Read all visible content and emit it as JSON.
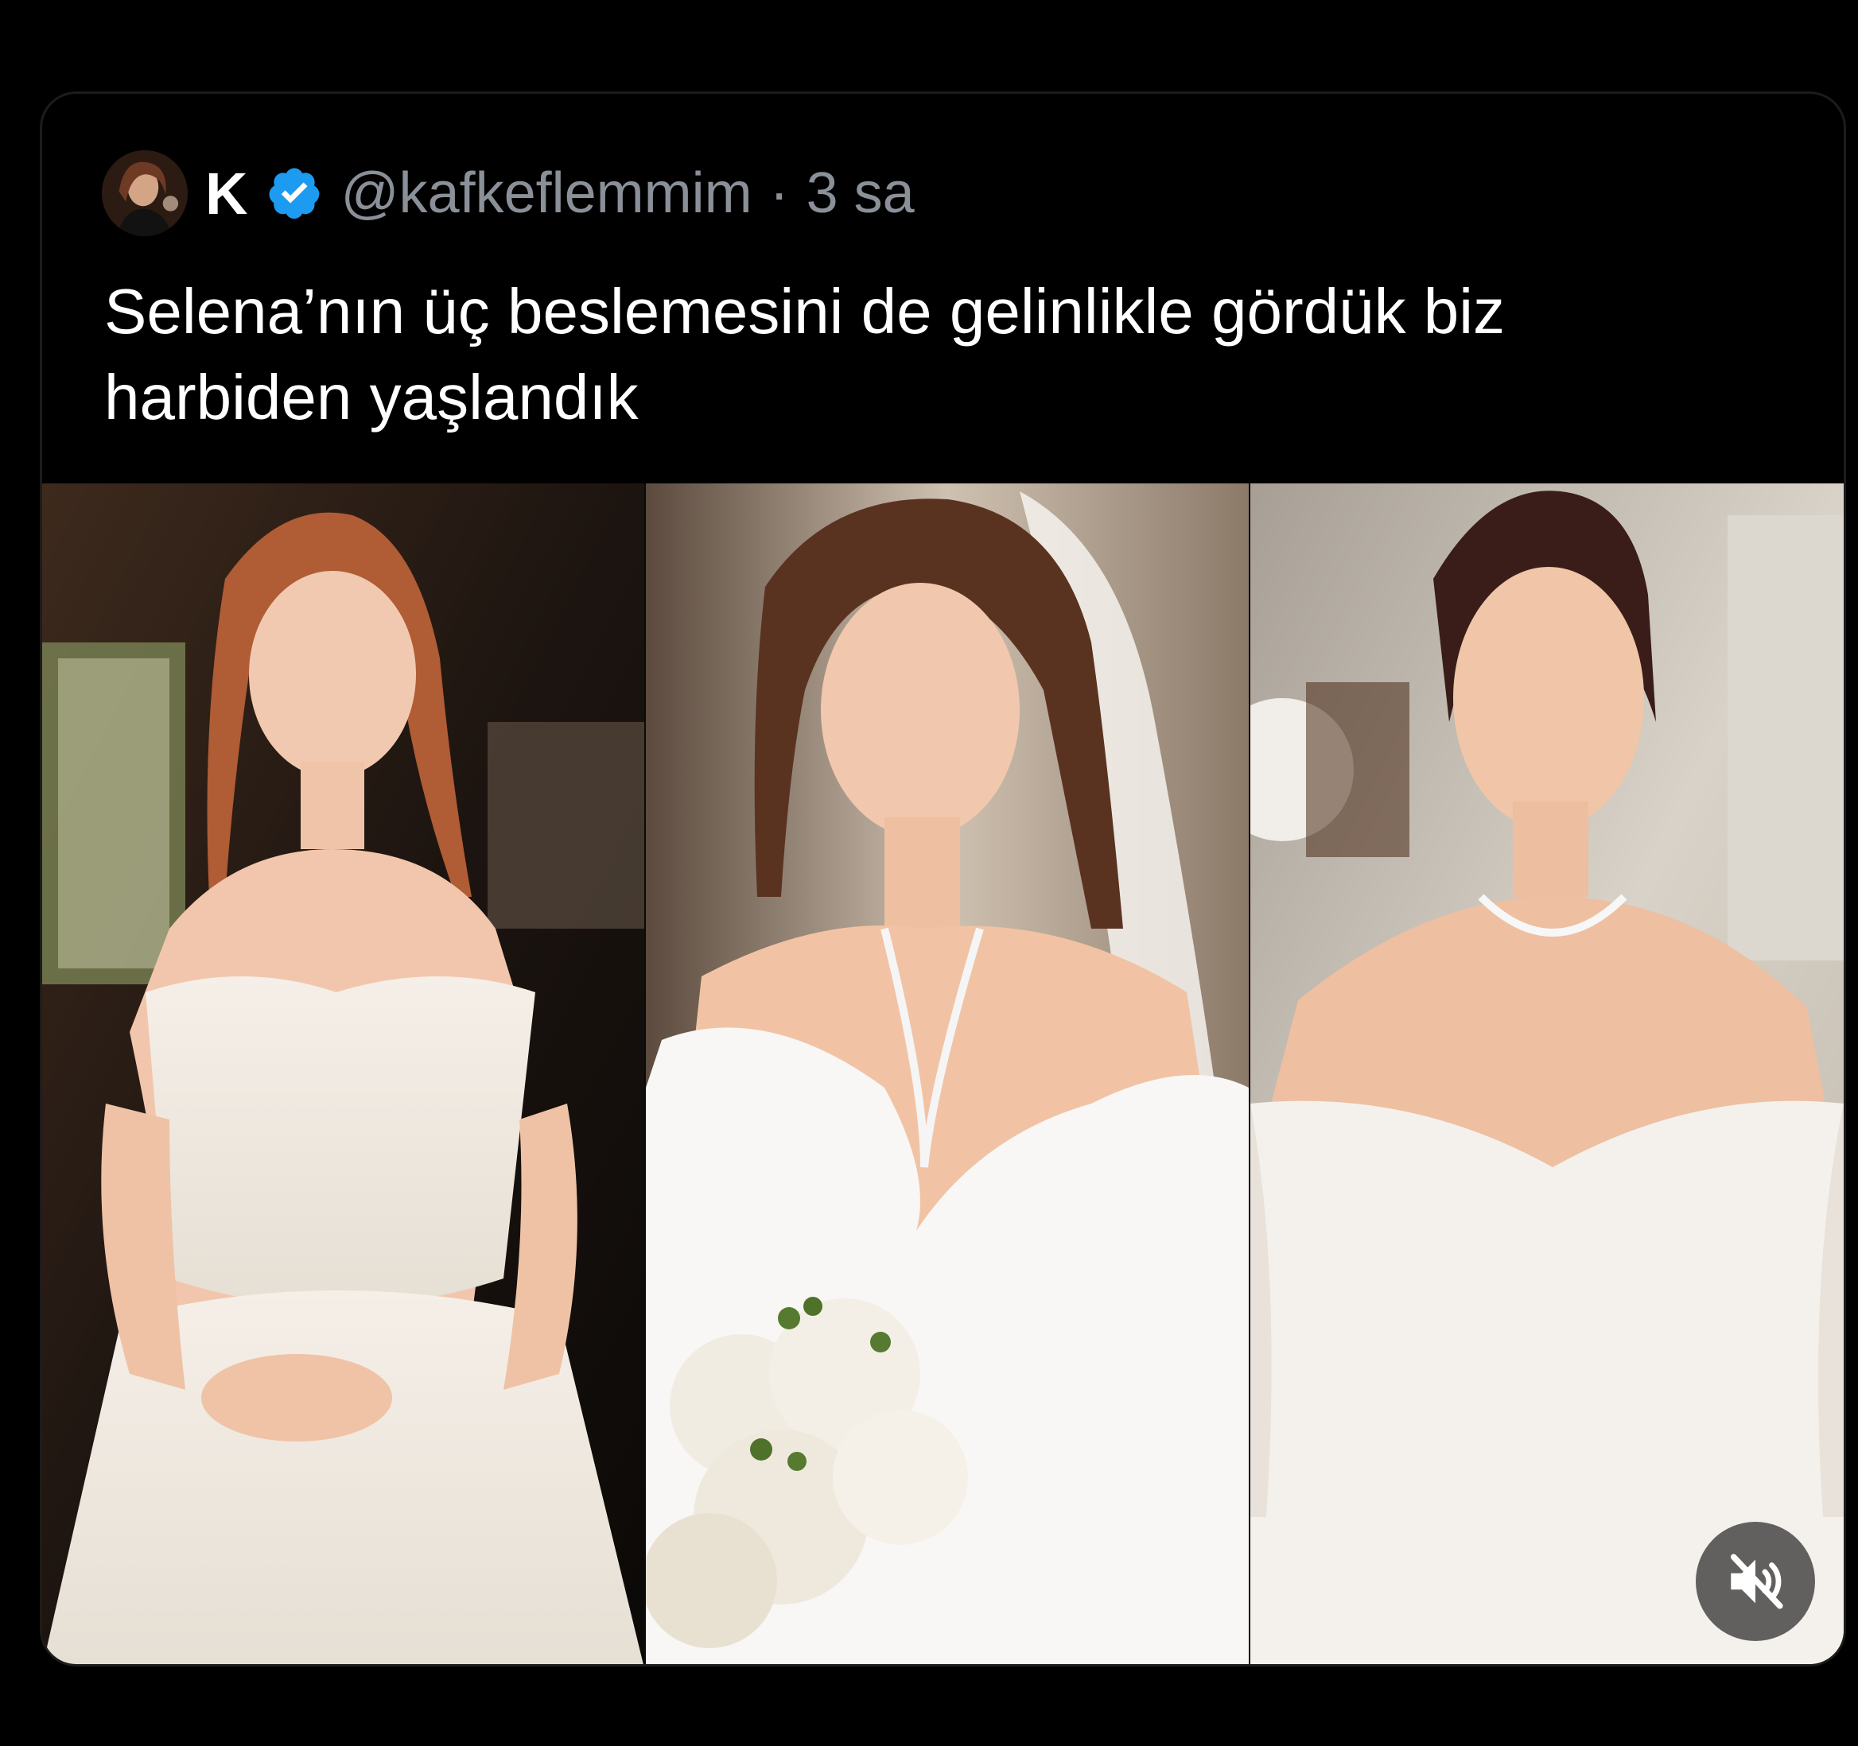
{
  "tweet": {
    "author_name": "K",
    "handle": "@kafkeflemmim",
    "separator": "·",
    "time": "3 sa",
    "text": "Selena’nın üç beslemesini de gelinlikle gördük biz\nharbiden yaşlandık"
  },
  "icons": {
    "verified": "verified-badge-icon",
    "mute": "speaker-muted-icon"
  },
  "colors": {
    "background": "#000000",
    "text": "#ffffff",
    "secondary_text": "#8a9098",
    "verified": "#1d9bf0"
  }
}
